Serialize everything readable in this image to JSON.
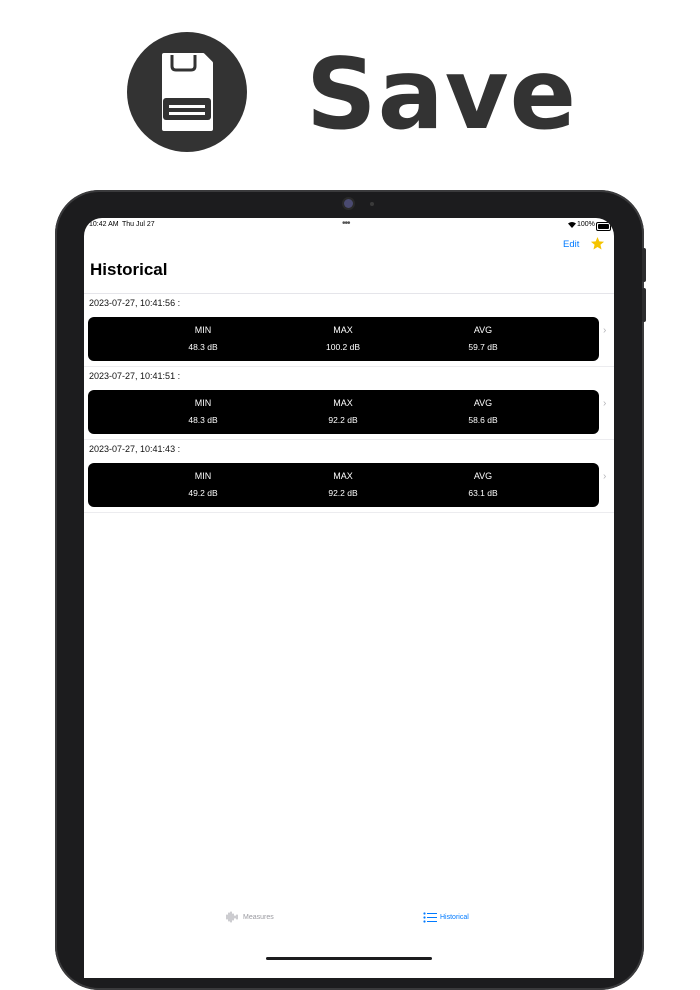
{
  "promo": {
    "title": "Save",
    "icon": "floppy-disk-icon"
  },
  "status_bar": {
    "time": "10:42 AM",
    "date": "Thu Jul 27",
    "battery": "100%"
  },
  "nav": {
    "edit_label": "Edit",
    "favorite_icon": "star-icon",
    "title": "Historical",
    "accent_color": "#007aff",
    "star_color": "#f5c400"
  },
  "records": [
    {
      "timestamp": "2023-07-27, 10:41:56 :",
      "stats": [
        {
          "label": "MIN",
          "value": "48.3 dB"
        },
        {
          "label": "MAX",
          "value": "100.2 dB"
        },
        {
          "label": "AVG",
          "value": "59.7 dB"
        }
      ]
    },
    {
      "timestamp": "2023-07-27, 10:41:51 :",
      "stats": [
        {
          "label": "MIN",
          "value": "48.3 dB"
        },
        {
          "label": "MAX",
          "value": "92.2 dB"
        },
        {
          "label": "AVG",
          "value": "58.6 dB"
        }
      ]
    },
    {
      "timestamp": "2023-07-27, 10:41:43 :",
      "stats": [
        {
          "label": "MIN",
          "value": "49.2 dB"
        },
        {
          "label": "MAX",
          "value": "92.2 dB"
        },
        {
          "label": "AVG",
          "value": "63.1 dB"
        }
      ]
    }
  ],
  "tab_bar": {
    "tabs": [
      {
        "label": "Measures",
        "icon": "waveform-icon",
        "selected": false
      },
      {
        "label": "Historical",
        "icon": "list-icon",
        "selected": true
      }
    ]
  }
}
